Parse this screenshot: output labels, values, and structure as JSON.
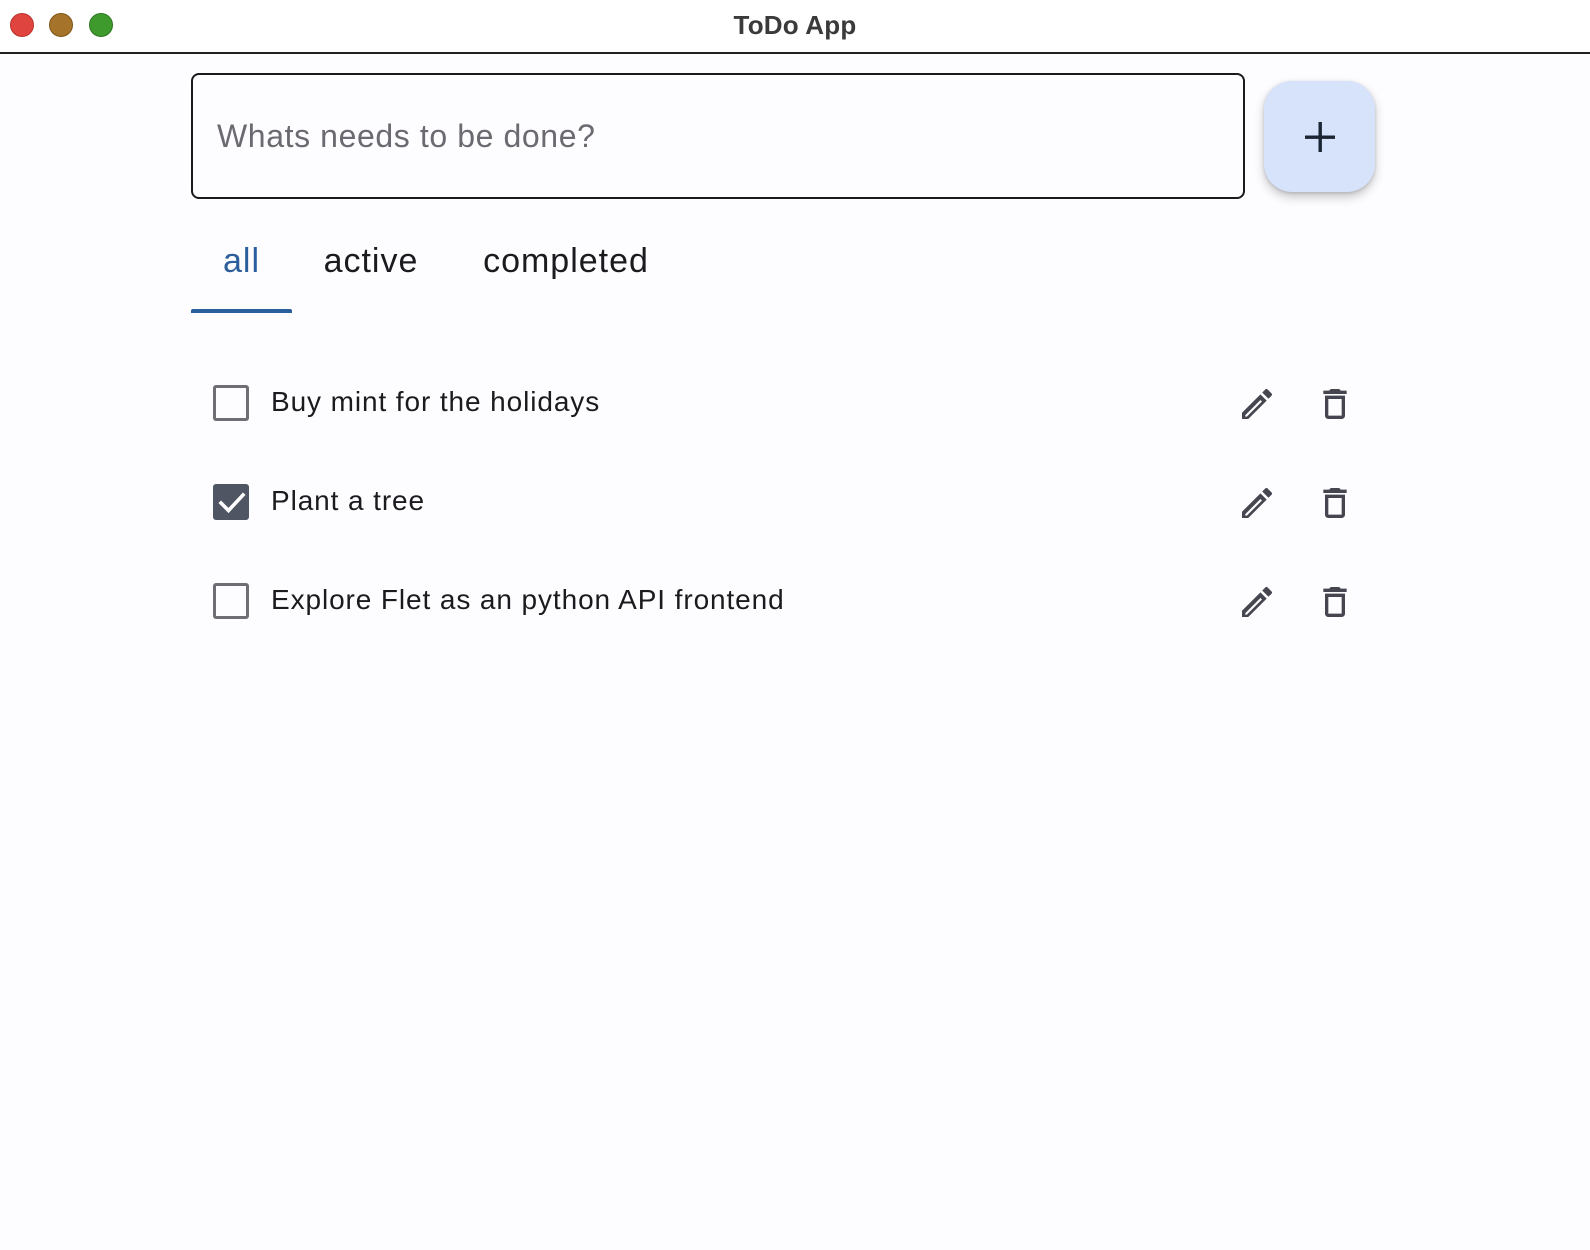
{
  "window": {
    "title": "ToDo App"
  },
  "new_task": {
    "placeholder": "Whats needs to be done?",
    "value": "",
    "add_icon": "plus-icon"
  },
  "tabs": [
    {
      "label": "all",
      "selected": true
    },
    {
      "label": "active",
      "selected": false
    },
    {
      "label": "completed",
      "selected": false
    }
  ],
  "tasks": [
    {
      "label": "Buy mint for the holidays",
      "completed": false,
      "edit_icon": "pencil-icon",
      "delete_icon": "trash-icon"
    },
    {
      "label": "Plant a tree",
      "completed": true,
      "edit_icon": "pencil-icon",
      "delete_icon": "trash-icon"
    },
    {
      "label": "Explore Flet as an python API frontend",
      "completed": false,
      "edit_icon": "pencil-icon",
      "delete_icon": "trash-icon"
    }
  ],
  "colors": {
    "accent": "#2a5f9c",
    "fab_background": "#d6e3fb",
    "checkbox_checked": "#4f5563",
    "icon": "#45464f",
    "text": "#1b1b1f"
  }
}
